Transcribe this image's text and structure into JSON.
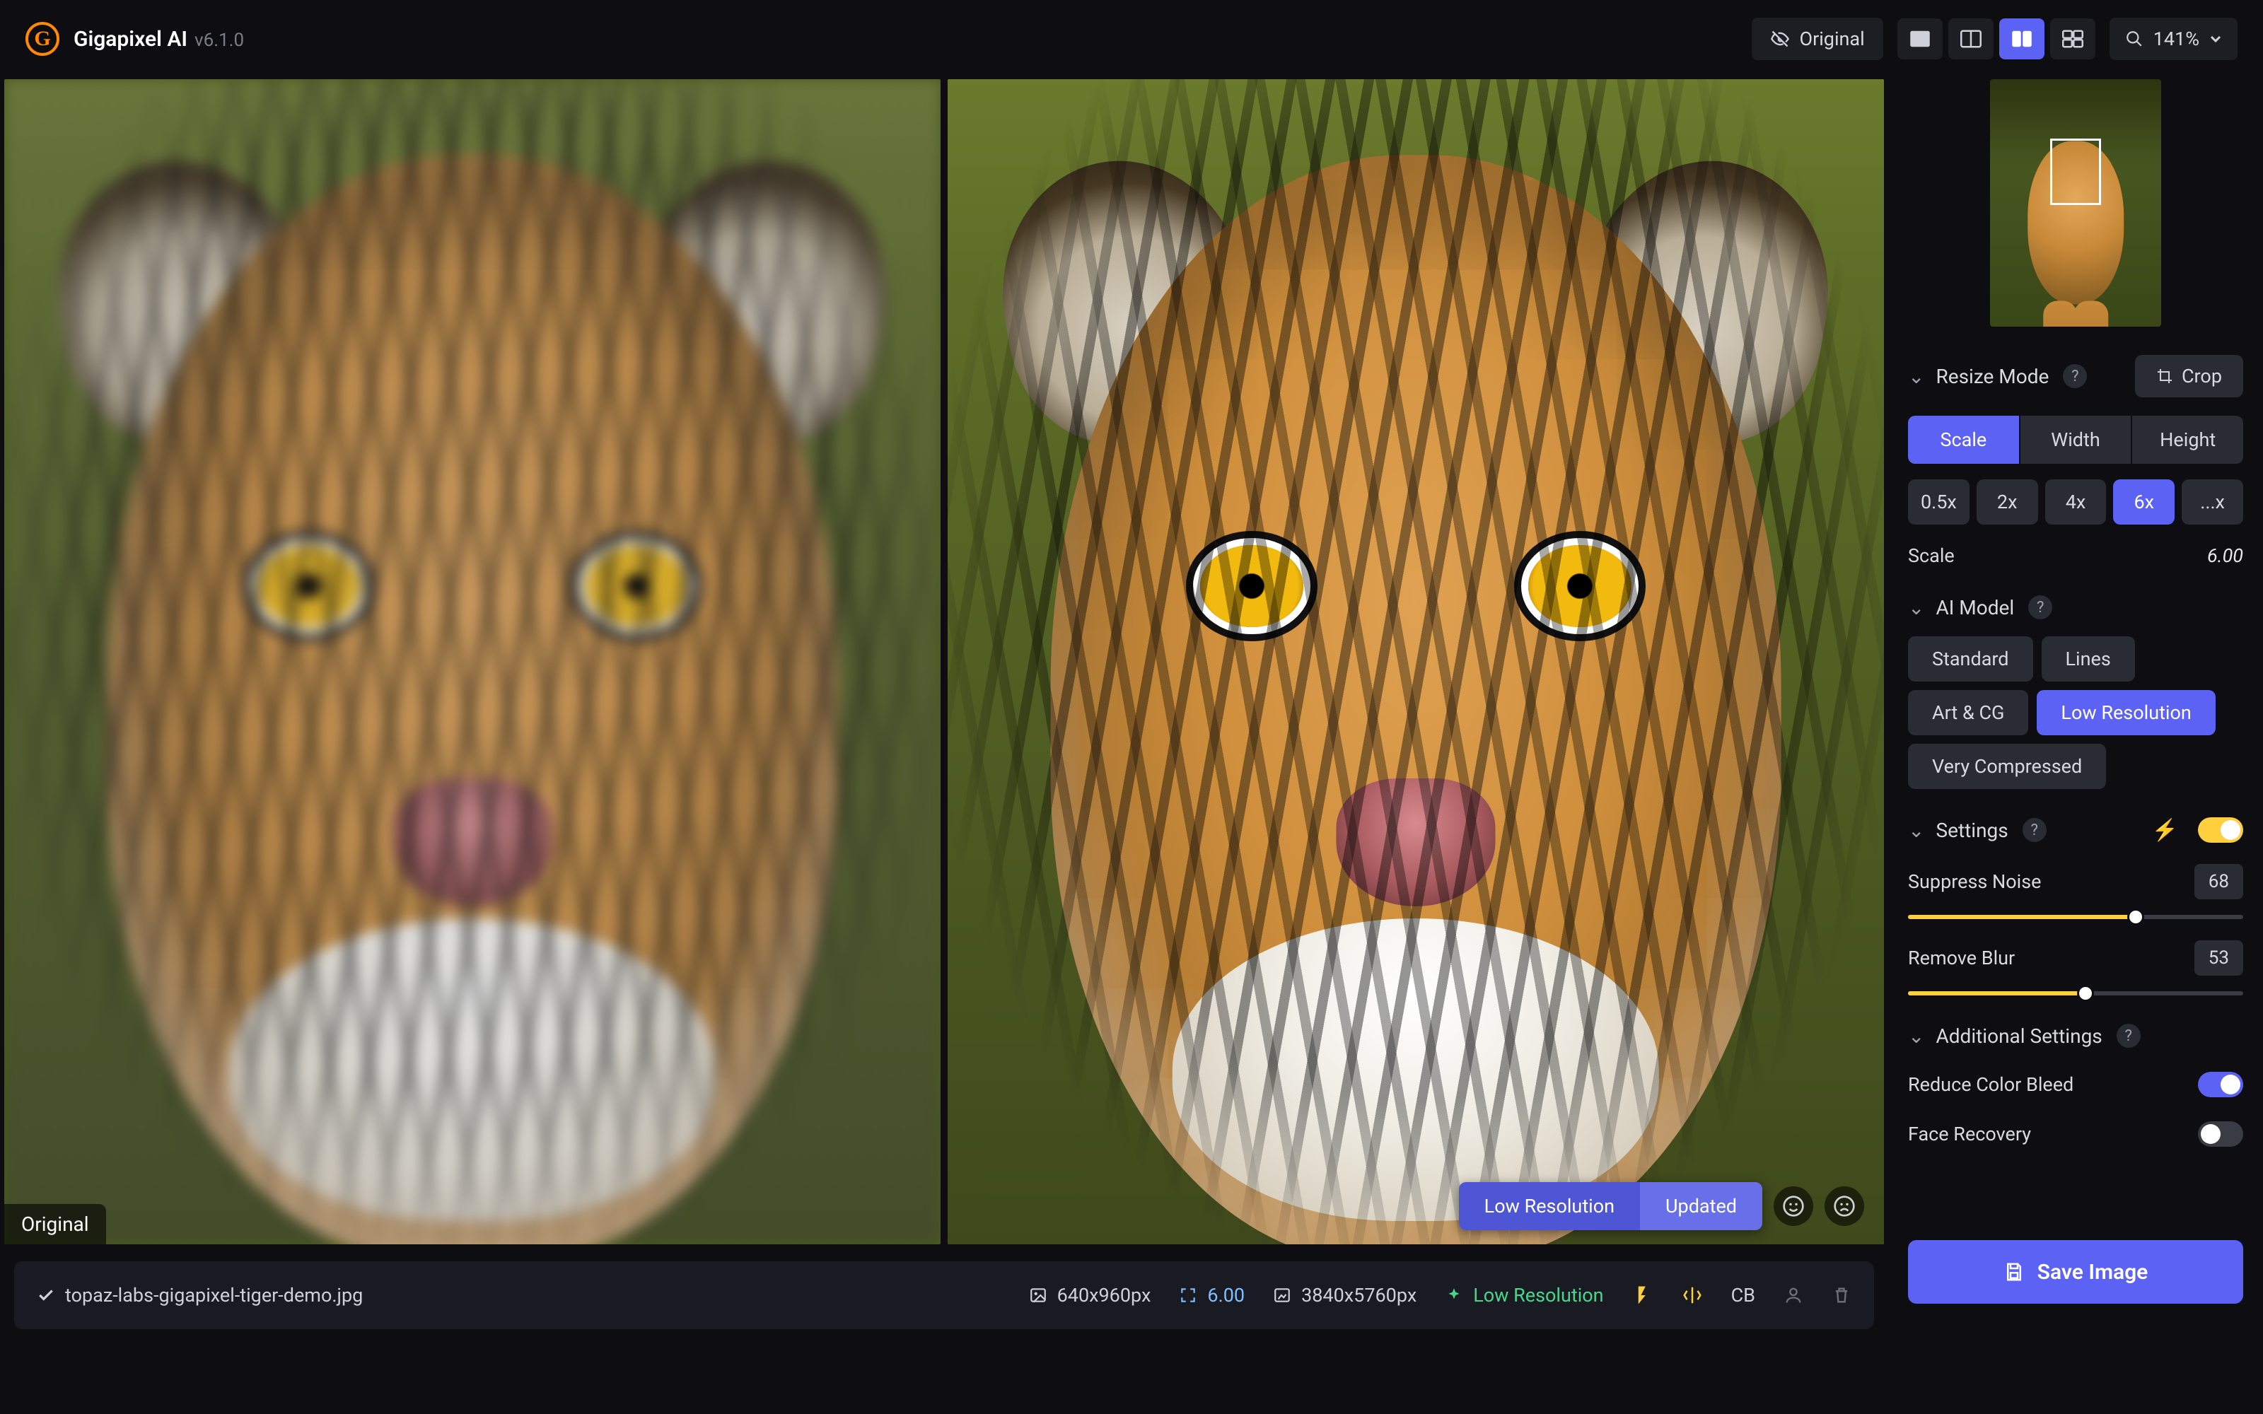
{
  "app": {
    "name": "Gigapixel AI",
    "version": "v6.1.0"
  },
  "toolbar": {
    "original_toggle": "Original",
    "zoom": "141%",
    "layout_icons": [
      "single-view-icon",
      "split-vertical-icon",
      "side-by-side-icon",
      "grid-view-icon"
    ],
    "active_layout_idx": 2
  },
  "viewer": {
    "left_label": "Original",
    "pill_left": "Low Resolution",
    "pill_right": "Updated"
  },
  "statusbar": {
    "filename": "topaz-labs-gigapixel-tiger-demo.jpg",
    "src_dims": "640x960px",
    "scale": "6.00",
    "out_dims": "3840x5760px",
    "model": "Low Resolution",
    "cb": "CB"
  },
  "side": {
    "resize": {
      "title": "Resize Mode",
      "crop": "Crop",
      "tabs": [
        "Scale",
        "Width",
        "Height"
      ],
      "active_tab": 0,
      "presets": [
        "0.5x",
        "2x",
        "4x",
        "6x",
        "...x"
      ],
      "active_preset": 3,
      "scale_label": "Scale",
      "scale_value": "6.00"
    },
    "model": {
      "title": "AI Model",
      "options": [
        "Standard",
        "Lines",
        "Art & CG",
        "Low Resolution",
        "Very Compressed"
      ],
      "active": 3
    },
    "settings": {
      "title": "Settings",
      "auto_on": true,
      "noise_label": "Suppress Noise",
      "noise_value": "68",
      "noise_pct": 68,
      "blur_label": "Remove Blur",
      "blur_value": "53",
      "blur_pct": 53
    },
    "addl": {
      "title": "Additional Settings",
      "color_label": "Reduce Color Bleed",
      "color_on": true,
      "face_label": "Face Recovery",
      "face_on": false
    },
    "save": "Save Image"
  }
}
